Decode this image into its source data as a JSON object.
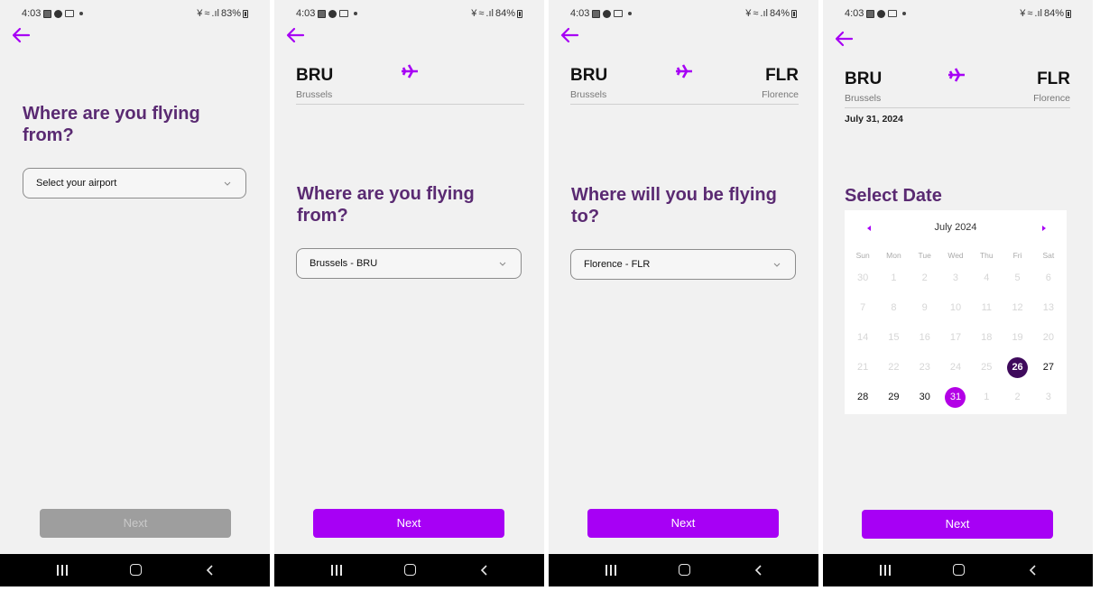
{
  "colors": {
    "accent": "#a700f5",
    "title_purple": "#5a2a72",
    "selected_day": "#3f0a5c",
    "today_day": "#b300e6",
    "disabled_button": "#9e9e9e"
  },
  "screens": [
    {
      "status": {
        "time": "4:03",
        "battery": "83%"
      },
      "question": "Where are you flying from?",
      "dropdown_value": "Select your airport",
      "next_label": "Next",
      "next_enabled": false
    },
    {
      "status": {
        "time": "4:03",
        "battery": "84%"
      },
      "from_code": "BRU",
      "from_city": "Brussels",
      "question": "Where are you flying from?",
      "dropdown_value": "Brussels - BRU",
      "next_label": "Next",
      "next_enabled": true
    },
    {
      "status": {
        "time": "4:03",
        "battery": "84%"
      },
      "from_code": "BRU",
      "from_city": "Brussels",
      "to_code": "FLR",
      "to_city": "Florence",
      "question": "Where will you be flying to?",
      "dropdown_value": "Florence - FLR",
      "next_label": "Next",
      "next_enabled": true
    },
    {
      "status": {
        "time": "4:03",
        "battery": "84%"
      },
      "from_code": "BRU",
      "from_city": "Brussels",
      "to_code": "FLR",
      "to_city": "Florence",
      "selected_date_label": "July 31, 2024",
      "title": "Select Date",
      "calendar": {
        "month_label": "July 2024",
        "weekdays": [
          "Sun",
          "Mon",
          "Tue",
          "Wed",
          "Thu",
          "Fri",
          "Sat"
        ],
        "weeks": [
          [
            "30",
            "1",
            "2",
            "3",
            "4",
            "5",
            "6"
          ],
          [
            "7",
            "8",
            "9",
            "10",
            "11",
            "12",
            "13"
          ],
          [
            "14",
            "15",
            "16",
            "17",
            "18",
            "19",
            "20"
          ],
          [
            "21",
            "22",
            "23",
            "24",
            "25",
            "26",
            "27"
          ],
          [
            "28",
            "29",
            "30",
            "31",
            "1",
            "2",
            "3"
          ]
        ],
        "selected_day": "26",
        "highlighted_day": "31"
      },
      "next_label": "Next",
      "next_enabled": true
    }
  ],
  "icons": {
    "back": "arrow-left-icon",
    "plane": "airplane-icon",
    "dropdown": "chevron-down-icon",
    "nav_recent": "recent-apps-icon",
    "nav_home": "home-icon",
    "nav_back": "back-icon"
  }
}
